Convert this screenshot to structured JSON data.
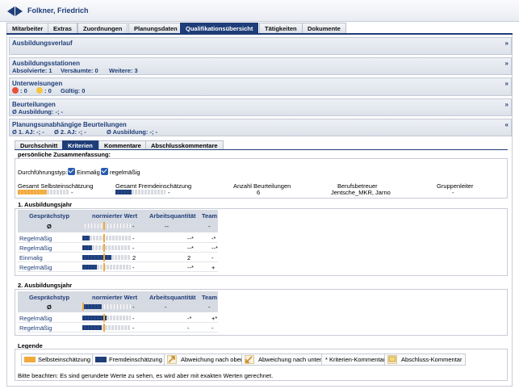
{
  "header": {
    "person_name": "Folkner, Friedrich"
  },
  "tabs": [
    {
      "label": "Mitarbeiter"
    },
    {
      "label": "Extras"
    },
    {
      "label": "Zuordnungen"
    },
    {
      "label": "Planungsdaten"
    },
    {
      "label": "Qualifikationsübersicht"
    },
    {
      "label": "Tätigkeiten"
    },
    {
      "label": "Dokumente"
    }
  ],
  "sections": {
    "ausbildungsverlauf": {
      "title": "Ausbildungsverlauf",
      "chevron": "»"
    },
    "ausbildungsstationen": {
      "title": "Ausbildungsstationen",
      "absolvierte": "Absolvierte: 1",
      "versaeumte": "Versäumte: 0",
      "weitere": "Weitere: 3",
      "chevron": "»"
    },
    "unterweisungen": {
      "title": "Unterweisungen",
      "red": ": 0",
      "yellow": ": 0",
      "gueltig": "Gültig: 0",
      "chevron": "»"
    },
    "beurteilungen": {
      "title": "Beurteilungen",
      "sub": "Ø Ausbildung: -; -",
      "chevron": "»"
    },
    "planungsunabhaengig": {
      "title": "Planungsunabhängige Beurteilungen",
      "aj1": "Ø 1. AJ: -; -",
      "aj2": "Ø 2. AJ: -; -",
      "ausbildung": "Ø Ausbildung: -; -",
      "chevron": "«"
    }
  },
  "subtabs": [
    {
      "label": "Durchschnitt"
    },
    {
      "label": "Kriterien"
    },
    {
      "label": "Kommentare"
    },
    {
      "label": "Abschlusskommentare"
    }
  ],
  "summary": {
    "title": "persönliche Zusammenfassung:",
    "type_label": "Durchführungstyp:",
    "einmalig": "Einmalig",
    "regelmaessig": "regelmäßig",
    "cols": {
      "selbst_label": "Gesamt Selbsteinschätzung",
      "selbst_value": "-",
      "fremd_label": "Gesamt Fremdeinschätzung",
      "fremd_value": "-",
      "anzahl_label": "Anzahl Beurteilungen",
      "anzahl_value": "6",
      "betreuer_label": "Berufsbetreuer",
      "betreuer_value": "Jentsche_MKR, Jarno",
      "gruppenleiter_label": "Gruppenleiter",
      "gruppenleiter_value": "-"
    }
  },
  "year1": {
    "title": "1. Ausbildungsjahr",
    "headers": {
      "typ": "Gesprächstyp",
      "wert": "normierter Wert",
      "arbeit": "Arbeitsquantität",
      "team": "Team"
    },
    "avg_row": {
      "typ": "Ø",
      "wert": "-",
      "arbeit": "--",
      "team": "-"
    },
    "rows": [
      {
        "typ": "Regelmäßig",
        "wert": "-",
        "arbeit": "--*",
        "team": "-*",
        "fill": 0.15
      },
      {
        "typ": "Regelmäßig",
        "wert": "-",
        "arbeit": "--*",
        "team": "--*",
        "fill": 0.2
      },
      {
        "typ": "Einmalig",
        "wert": "2",
        "arbeit": "2",
        "team": "-",
        "fill": 0.6
      },
      {
        "typ": "Regelmäßig",
        "wert": "-",
        "arbeit": "--*",
        "team": "+",
        "fill": 0.3
      }
    ]
  },
  "year2": {
    "title": "2. Ausbildungsjahr",
    "headers": {
      "typ": "Gesprächstyp",
      "wert": "normierter Wert",
      "arbeit": "Arbeitsquantität",
      "team": "Team"
    },
    "avg_row": {
      "typ": "Ø",
      "wert": "-",
      "arbeit": "-",
      "team": "-"
    },
    "rows": [
      {
        "typ": "Regelmäßig",
        "wert": "-",
        "arbeit": "-*",
        "team": "+*",
        "fill": 0.5
      },
      {
        "typ": "Regelmäßig",
        "wert": "-",
        "arbeit": "-",
        "team": "-",
        "fill": 0.4
      }
    ]
  },
  "legend": {
    "title": "Legende",
    "selbst": "Selbsteinschätzung",
    "fremd": "Fremdeinschätzung",
    "oben": "Abweichung nach oben",
    "unten": "Abweichung nach unten",
    "kommentar": "* Kriterien-Kommentar",
    "abschluss": "Abschluss-Kommentar",
    "note": "Bitte beachten: Es sind gerundete Werte zu sehen, es wird aber mit exakten Werten gerechnet."
  },
  "colors": {
    "navy": "#1f3d78",
    "orange": "#f2a93b",
    "red": "#e8503a",
    "yellow": "#f5c542"
  }
}
